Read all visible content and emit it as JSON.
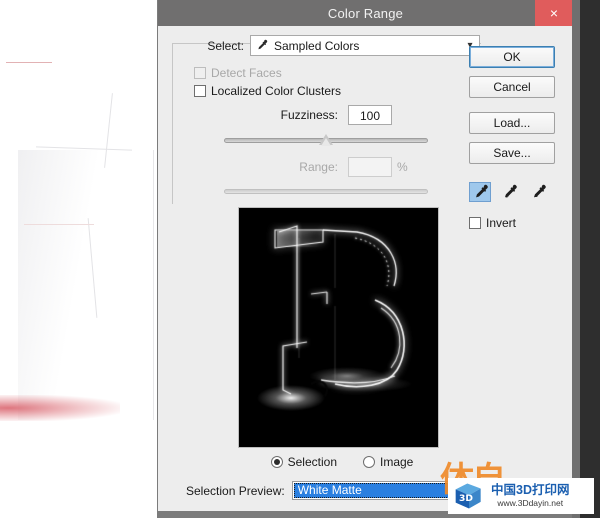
{
  "window": {
    "title": "Color Range",
    "close_icon": "close-icon",
    "close_label": "×"
  },
  "select_group": {
    "select_label": "Select:",
    "select_value": "Sampled Colors",
    "select_icon": "eyedropper-icon",
    "chevron_icon": "chevron-down-icon",
    "detect_faces_label": "Detect Faces",
    "detect_faces_checked": false,
    "detect_faces_enabled": false,
    "localized_label": "Localized Color Clusters",
    "localized_checked": false,
    "fuzziness_label": "Fuzziness:",
    "fuzziness_value": "100",
    "fuzziness_slider_percent": 50,
    "range_label": "Range:",
    "range_value": "",
    "range_percent_suffix": "%",
    "range_enabled": false,
    "range_slider_percent": 0
  },
  "preview": {
    "description": "selection mask preview showing white outline of letter B on black",
    "mode_selection_label": "Selection",
    "mode_image_label": "Image",
    "mode_selected": "Selection"
  },
  "selection_preview": {
    "label": "Selection Preview:",
    "value": "White Matte",
    "focused": true
  },
  "buttons": {
    "ok": "OK",
    "cancel": "Cancel",
    "load": "Load...",
    "save": "Save...",
    "ok_focused": true
  },
  "eyedroppers": {
    "sample_icon": "eyedropper-icon",
    "add_icon": "eyedropper-plus-icon",
    "subtract_icon": "eyedropper-minus-icon",
    "active": "sample"
  },
  "invert": {
    "label": "Invert",
    "checked": false
  },
  "watermark": {
    "logo_text": "3D",
    "main_text": "中国3D打印网",
    "sub_text": "www.3Ddayin.net",
    "brush_text": "体自"
  },
  "colors": {
    "titlebar": "#706f6f",
    "dialog_body": "#ededed",
    "close_button": "#e05c5c",
    "highlight_blue": "#2a7fe0",
    "tool_active_blue": "#9fc8ec",
    "focus_border": "#3c7fb1",
    "watermark_blue": "#1b5fb0",
    "watermark_orange": "#f08b2a",
    "canvas_accent_red": "#d85e68"
  }
}
